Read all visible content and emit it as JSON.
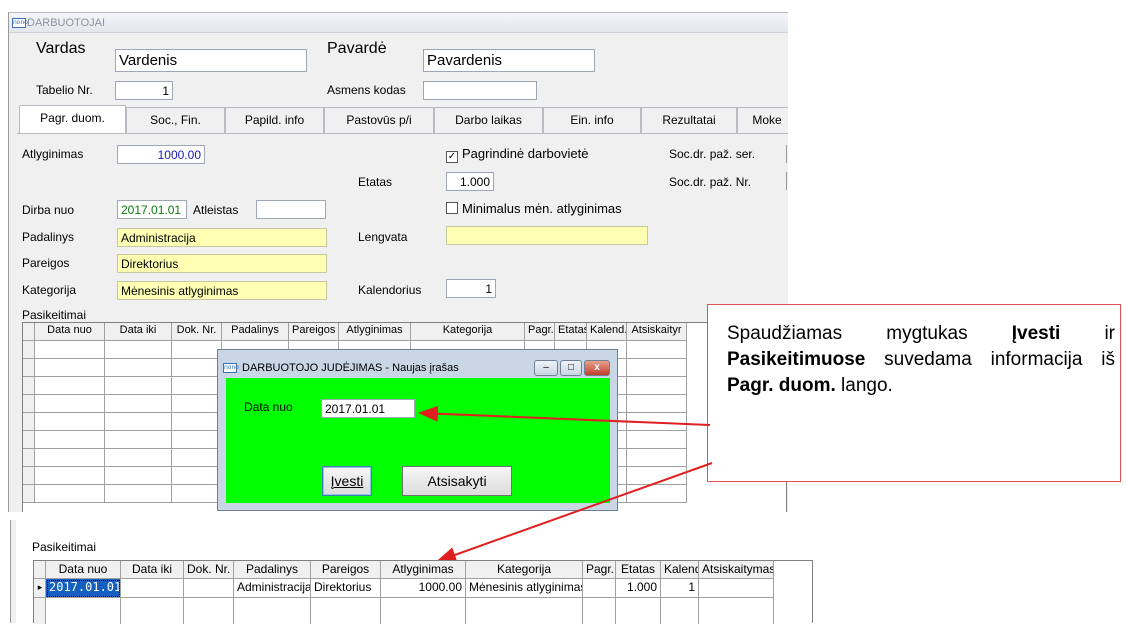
{
  "main_window": {
    "title": "DARBUOTOJAI",
    "icon_text": "nono",
    "vardas_label": "Vardas",
    "vardas_value": "Vardenis",
    "pavarde_label": "Pavardė",
    "pavarde_value": "Pavardenis",
    "tabelio_label": "Tabelio Nr.",
    "tabelio_value": "1",
    "asmens_label": "Asmens kodas",
    "asmens_value": ""
  },
  "tabs": [
    {
      "label": "Pagr. duom."
    },
    {
      "label": "Soc., Fin."
    },
    {
      "label": "Papild. info"
    },
    {
      "label": "Pastovūs p/i"
    },
    {
      "label": "Darbo laikas"
    },
    {
      "label": "Ein. info"
    },
    {
      "label": "Rezultatai"
    },
    {
      "label": "Moke"
    }
  ],
  "form": {
    "atlyginimas_label": "Atlyginimas",
    "atlyginimas_value": "1000.00",
    "pagrindine_label": "Pagrindinė darbovietė",
    "pagrindine_checked": true,
    "soc_ser_label": "Soc.dr. paž. ser.",
    "etatas_label": "Etatas",
    "etatas_value": "1.000",
    "soc_nr_label": "Soc.dr. paž. Nr.",
    "dirba_label": "Dirba nuo",
    "dirba_value": "2017.01.01",
    "atleistas_label": "Atleistas",
    "atleistas_value": "",
    "minimalus_label": "Minimalus mėn. atlyginimas",
    "minimalus_checked": false,
    "padalinys_label": "Padalinys",
    "padalinys_value": "Administracija",
    "lengvata_label": "Lengvata",
    "lengvata_value": "",
    "pareigos_label": "Pareigos",
    "pareigos_value": "Direktorius",
    "kategorija_label": "Kategorija",
    "kategorija_value": "Mėnesinis atlyginimas",
    "kalendorius_label": "Kalendorius",
    "kalendorius_value": "1",
    "pasikeitimai_label": "Pasikeitimai"
  },
  "grid_columns": [
    "Data nuo",
    "Data iki",
    "Dok. Nr.",
    "Padalinys",
    "Pareigos",
    "Atlyginimas",
    "Kategorija",
    "Pagr.",
    "Etatas",
    "Kalend.",
    "Atsiskaityr"
  ],
  "dialog": {
    "icon_text": "nono",
    "title": "DARBUOTOJO JUDĖJIMAS - Naujas įrašas",
    "minimize": "–",
    "maximize": "□",
    "close": "x",
    "data_nuo_label": "Data nuo",
    "data_nuo_value": "2017.01.01",
    "ivesti_label": "Įvesti",
    "atsisakyti_label": "Atsisakyti"
  },
  "callout": {
    "part1": "Spaudžiamas mygtukas ",
    "bold1": "Įvesti",
    "part2": " ir ",
    "bold2": "Pasikeitimuose",
    "part3": " suvedama informacija iš ",
    "bold3": "Pagr. duom.",
    "part4": " lango."
  },
  "bottom": {
    "pasikeitimai_label": "Pasikeitimai",
    "columns": [
      "Data nuo",
      "Data iki",
      "Dok. Nr.",
      "Padalinys",
      "Pareigos",
      "Atlyginimas",
      "Kategorija",
      "Pagr.",
      "Etatas",
      "Kalend.",
      "Atsiskaitymas"
    ],
    "row": [
      "2017.01.01",
      "",
      "",
      "Administracija",
      "Direktorius",
      "1000.00",
      "Mėnesinis atlyginimas",
      "",
      "1.000",
      "1",
      ""
    ],
    "row_indicator": "▸"
  },
  "colors": {
    "dialog_body": "#00ff00",
    "field_yellow": "#ffffb4",
    "arrow_red": "#e02020"
  }
}
